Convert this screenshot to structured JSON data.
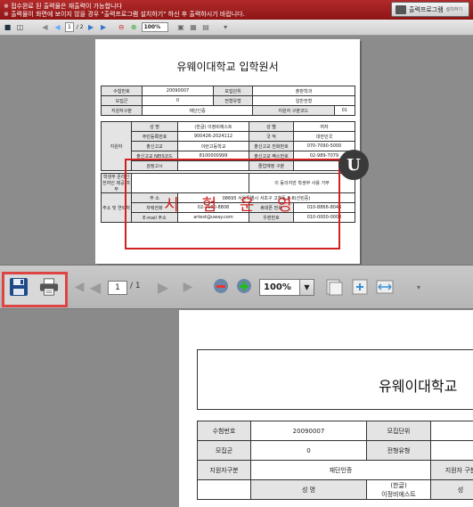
{
  "notice": {
    "line1": "※ 접수완료 된 출력물은 재출력이 가능합니다",
    "line2": "※ 출력물이 화면에 보이지 않을 경우 \"출력프로그램 설치하기\" 하신 후 출력하시기 바랍니다.",
    "button_label": "출력프로그램",
    "button_sub": "설치하기"
  },
  "toolbar_small": {
    "page": "1",
    "total": "/ 2",
    "zoom": "100%"
  },
  "page1": {
    "title": "유웨이대학교 입학원서",
    "r1": [
      "수험번호",
      "20090007",
      "모집단위",
      "",
      "",
      "출판학과"
    ],
    "r2": [
      "모집군",
      "0",
      "전형유형",
      "",
      "",
      "일반전형"
    ],
    "r3": [
      "지원자구분",
      "재단인증",
      "지원자 구분코드",
      "01"
    ],
    "r4": [
      "성 명",
      "(한글)\n이정비에스트",
      "성 별",
      "여자"
    ],
    "r5": [
      "주민등록번호",
      "900426-2024112",
      "국 적",
      "대한민국"
    ],
    "side_label": "지원자",
    "r6": [
      "출신고교",
      "이런고등학교",
      "출신고교 전화번호",
      "070-7090-5000"
    ],
    "r7": [
      "출신고교 NEIS코드",
      "8100000999",
      "출신고교 팩스번호",
      "02-989-7079"
    ],
    "r8": [
      "검정고시",
      "",
      "졸업예정 구분",
      ""
    ],
    "r9": [
      "학생부 온라인\n전자인 제공 여부",
      "",
      "이 동의지만 학생부 사용 거부"
    ],
    "r10": [
      "주 소",
      "08695 서울특별시 서초구 고척동 6-8(선린중)"
    ],
    "r11": [
      "자택전화",
      "02-2100-8808",
      "휴대폰 번호",
      "010-8866-8046"
    ],
    "r12": [
      "E-mail 주소",
      "artest@uway.com",
      "우편번호",
      "010-0000-0000"
    ],
    "addr_label": "주소 및 연락처",
    "stamp": "시 험 운 영",
    "logo": "U"
  },
  "toolbar_main": {
    "page": "1",
    "total": "/ 1",
    "zoom": "100%"
  },
  "page2": {
    "title": "유웨이대학교",
    "rows": [
      [
        "수험번호",
        "20090007",
        "모집단위"
      ],
      [
        "모집군",
        "0",
        "전형유형"
      ],
      [
        "지원자구분",
        "재단인증",
        "지원자 구분"
      ],
      [
        "성 명",
        "(한글)\n이정비에스트",
        "성"
      ]
    ]
  }
}
